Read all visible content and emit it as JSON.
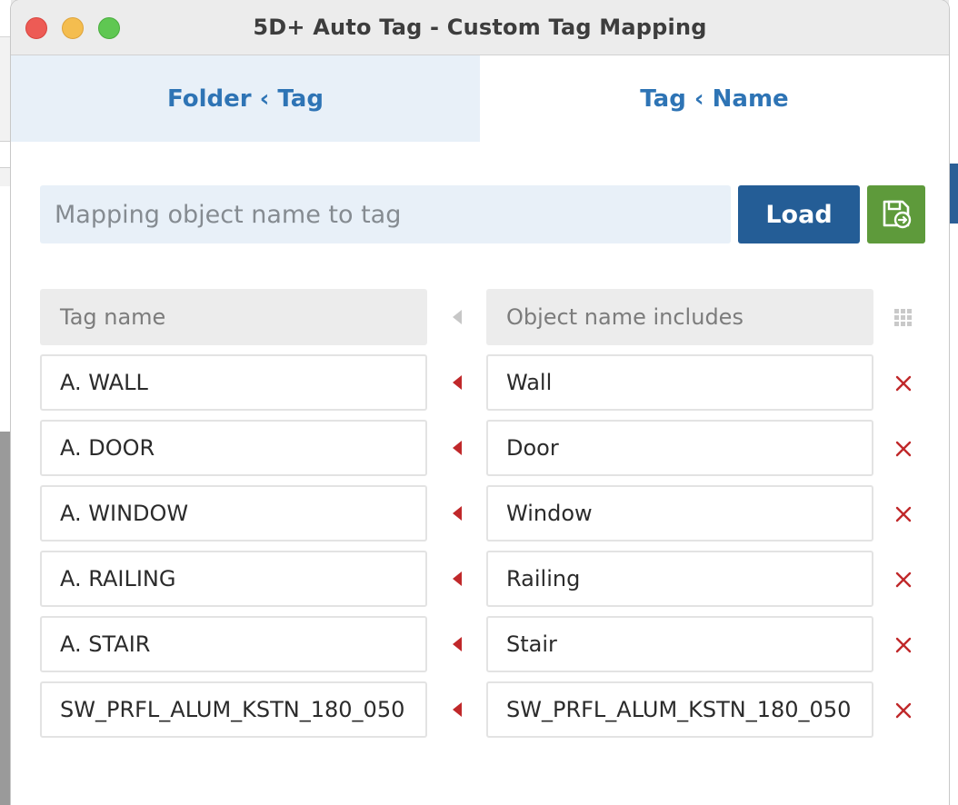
{
  "window": {
    "title": "5D+ Auto Tag - Custom Tag Mapping"
  },
  "tabs": [
    {
      "label": "Folder ‹ Tag",
      "active": false
    },
    {
      "label": "Tag ‹ Name",
      "active": true
    }
  ],
  "search": {
    "placeholder": "Mapping object name to tag",
    "value": ""
  },
  "buttons": {
    "load_label": "Load",
    "save_icon": "save-load-icon"
  },
  "table": {
    "headers": {
      "tag_name": "Tag name",
      "object_name": "Object name includes"
    },
    "rows": [
      {
        "tag": "A. WALL",
        "object": "Wall"
      },
      {
        "tag": "A. DOOR",
        "object": "Door"
      },
      {
        "tag": "A. WINDOW",
        "object": "Window"
      },
      {
        "tag": "A. RAILING",
        "object": "Railing"
      },
      {
        "tag": "A. STAIR",
        "object": "Stair"
      },
      {
        "tag": "SW_PRFL_ALUM_KSTN_180_050",
        "object": "SW_PRFL_ALUM_KSTN_180_050"
      }
    ]
  },
  "colors": {
    "accent_blue": "#2e74b5",
    "load_button": "#245d96",
    "save_button": "#5e9a3b",
    "arrow_red": "#c0282a",
    "remove_red": "#c0282a"
  }
}
